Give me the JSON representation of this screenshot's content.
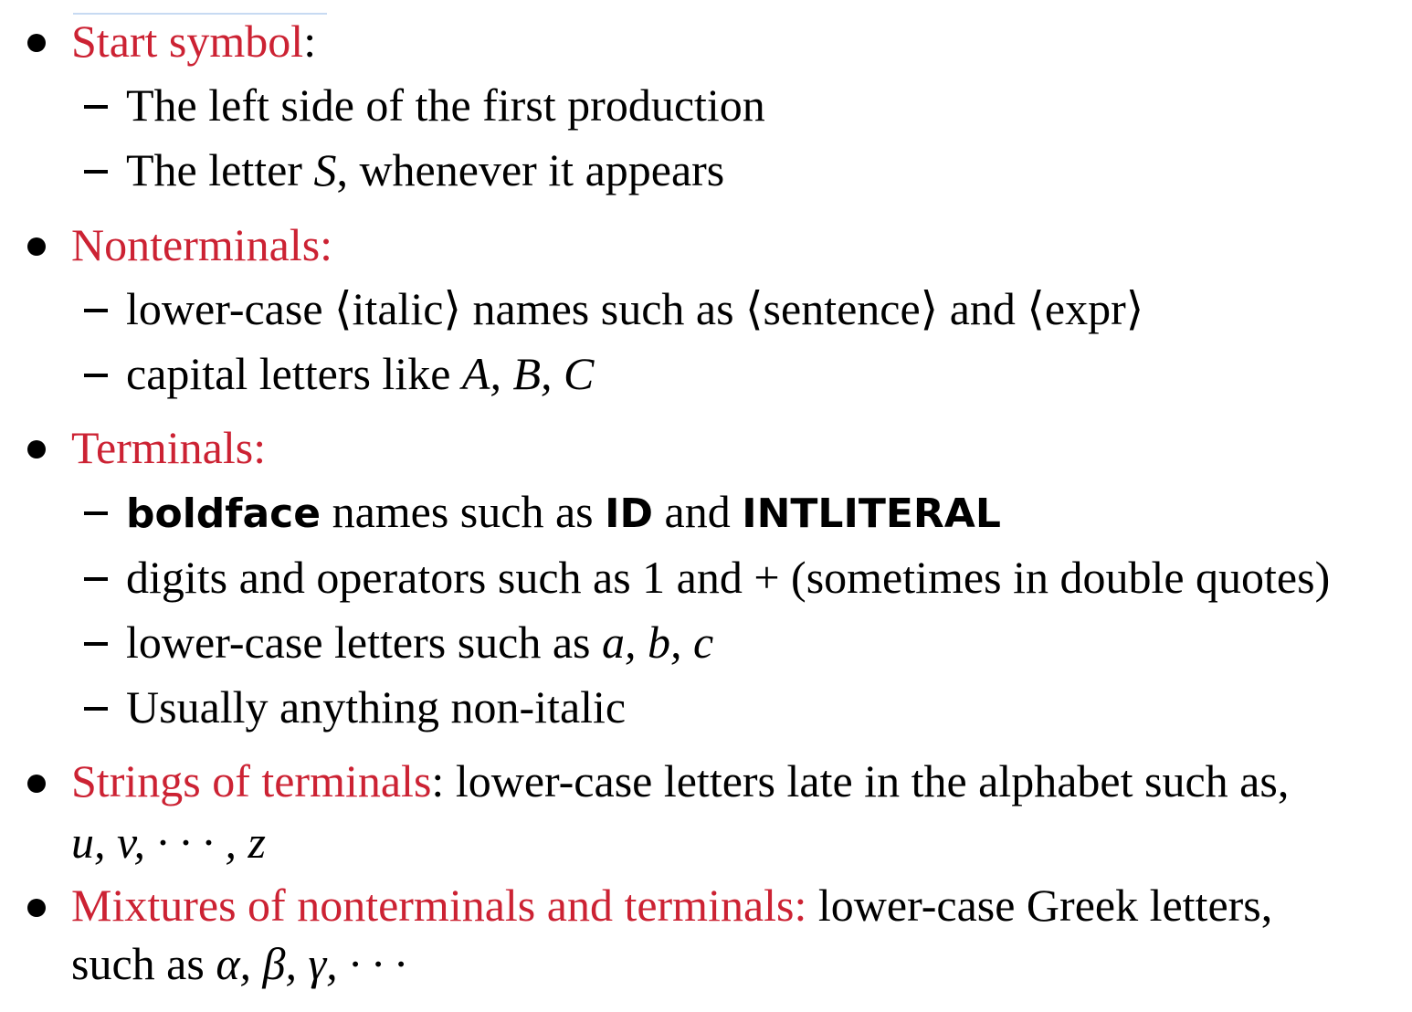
{
  "colors": {
    "heading": "#cc2233",
    "text": "#000000",
    "rule": "#c7daf2"
  },
  "items": [
    {
      "heading": "Start symbol",
      "suffix": ":",
      "subitems": [
        {
          "text": "The left side of the first production"
        },
        {
          "pre": "The letter ",
          "math": "S",
          "post": ", whenever it appears"
        }
      ]
    },
    {
      "heading": "Nonterminals:",
      "subitems": [
        {
          "a": "lower-case ",
          "b": "⟨italic⟩",
          "c": " names such as ",
          "d": "⟨sentence⟩",
          "e": " and ",
          "f": "⟨expr⟩"
        },
        {
          "pre": "capital letters like ",
          "math": "A, B, C"
        }
      ]
    },
    {
      "heading": "Terminals:",
      "subitems": [
        {
          "bold1": "boldface",
          "mid1": " names such as ",
          "bold2": "ID",
          "mid2": " and ",
          "bold3": "INTLITERAL"
        },
        {
          "text": "digits and operators such as 1 and + (sometimes in double quotes)"
        },
        {
          "pre": "lower-case letters such as ",
          "math": "a, b, c"
        },
        {
          "text": "Usually anything non-italic"
        }
      ]
    },
    {
      "heading": "Strings of terminals",
      "rest": ": lower-case letters late in the alphabet such as,",
      "cont_math": "u, v, · · · , z"
    },
    {
      "heading": "Mixtures of nonterminals and terminals:",
      "rest": " lower-case Greek letters,",
      "cont_pre": "such as ",
      "cont_math": "α, β, γ, · · ·"
    }
  ]
}
